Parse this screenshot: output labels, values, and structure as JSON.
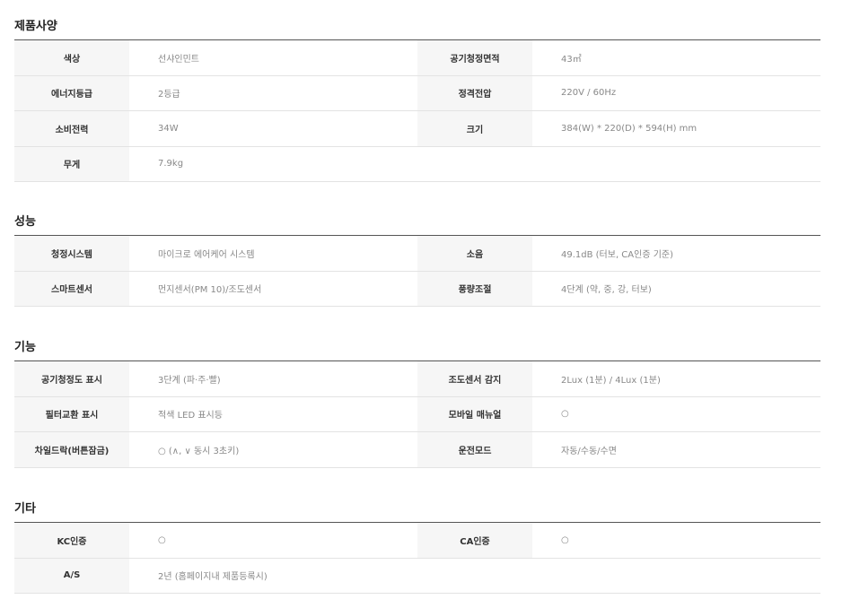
{
  "sections": [
    {
      "title": "제품사양",
      "rows": [
        [
          {
            "label": "색상",
            "value": "선샤인민트"
          },
          {
            "label": "공기청정면적",
            "value": "43㎡"
          }
        ],
        [
          {
            "label": "에너지등급",
            "value": "2등급"
          },
          {
            "label": "정격전압",
            "value": "220V / 60Hz"
          }
        ],
        [
          {
            "label": "소비전력",
            "value": "34W"
          },
          {
            "label": "크기",
            "value": "384(W) * 220(D) * 594(H) mm"
          }
        ],
        [
          {
            "label": "무게",
            "value": "7.9kg"
          },
          {
            "label": "",
            "value": ""
          }
        ]
      ]
    },
    {
      "title": "성능",
      "rows": [
        [
          {
            "label": "청정시스템",
            "value": "마이크로 에어케어 시스템"
          },
          {
            "label": "소음",
            "value": "49.1dB (터보, CA인증 기준)"
          }
        ],
        [
          {
            "label": "스마트센서",
            "value": "먼지센서(PM 10)/조도센서"
          },
          {
            "label": "풍량조절",
            "value": "4단계 (약, 중, 강, 터보)"
          }
        ]
      ]
    },
    {
      "title": "기능",
      "rows": [
        [
          {
            "label": "공기청정도 표시",
            "value": "3단계 (파·주·빨)"
          },
          {
            "label": "조도센서 감지",
            "value": "2Lux (1분) / 4Lux (1분)"
          }
        ],
        [
          {
            "label": "필터교환 표시",
            "value": "적색 LED 표시등"
          },
          {
            "label": "모바일 매뉴얼",
            "value": "○"
          }
        ],
        [
          {
            "label": "차일드락(버튼잠금)",
            "value": "○ (∧, ∨ 동시 3초키)"
          },
          {
            "label": "운전모드",
            "value": "자동/수동/수면"
          }
        ]
      ]
    },
    {
      "title": "기타",
      "rows": [
        [
          {
            "label": "KC인증",
            "value": "○"
          },
          {
            "label": "CA인증",
            "value": "○"
          }
        ],
        [
          {
            "label": "A/S",
            "value": "2년 (홈페이지내 제품등록시)"
          },
          {
            "label": "",
            "value": ""
          }
        ]
      ]
    }
  ]
}
